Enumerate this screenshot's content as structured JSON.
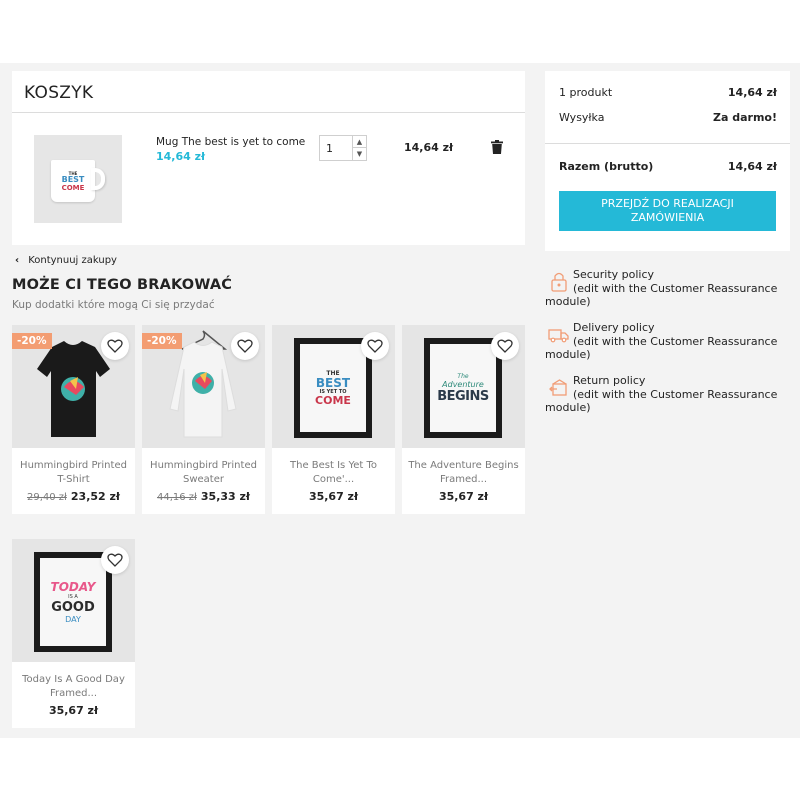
{
  "cart": {
    "title": "KOSZYK",
    "item": {
      "name": "Mug The best is yet to come",
      "price": "14,64 zł",
      "quantity": "1",
      "line_total": "14,64 zł",
      "thumb_text": [
        "THE",
        "BEST",
        "COME"
      ]
    }
  },
  "continue_label": "Kontynuuj zakupy",
  "crosssell": {
    "title": "MOŻE CI TEGO BRAKOWAĆ",
    "subtitle": "Kup dodatki które mogą Ci się przydać",
    "products": [
      {
        "name": "Hummingbird Printed T-Shirt",
        "old_price": "29,40 zł",
        "price": "23,52 zł",
        "badge": "-20%"
      },
      {
        "name": "Hummingbird Printed Sweater",
        "old_price": "44,16 zł",
        "price": "35,33 zł",
        "badge": "-20%"
      },
      {
        "name": "The Best Is Yet To Come'...",
        "old_price": "",
        "price": "35,67 zł",
        "badge": "",
        "art": [
          "THE",
          "BEST",
          "IS YET TO",
          "COME"
        ]
      },
      {
        "name": "The Adventure Begins Framed...",
        "old_price": "",
        "price": "35,67 zł",
        "badge": "",
        "art": [
          "The",
          "Adventure",
          "BEGINS"
        ]
      },
      {
        "name": "Today Is A Good Day Framed...",
        "old_price": "",
        "price": "35,67 zł",
        "badge": "",
        "art": [
          "TODAY",
          "IS A",
          "GOOD",
          "DAY"
        ]
      }
    ]
  },
  "summary": {
    "products_label": "1 produkt",
    "products_value": "14,64 zł",
    "shipping_label": "Wysyłka",
    "shipping_value": "Za darmo!",
    "total_label": "Razem (brutto)",
    "total_value": "14,64 zł",
    "checkout_line1": "PRZEJDŹ DO REALIZACJI",
    "checkout_line2": "ZAMÓWIENIA"
  },
  "reassurance": [
    {
      "title": "Security policy",
      "sub": "(edit with the Customer Reassurance module)",
      "icon": "lock-icon"
    },
    {
      "title": "Delivery policy",
      "sub": "(edit with the Customer Reassurance module)",
      "icon": "truck-icon"
    },
    {
      "title": "Return policy",
      "sub": "(edit with the Customer Reassurance module)",
      "icon": "return-box-icon"
    }
  ],
  "colors": {
    "accent": "#24b9d7",
    "badge": "#f39d72",
    "icon": "#f19d76"
  }
}
